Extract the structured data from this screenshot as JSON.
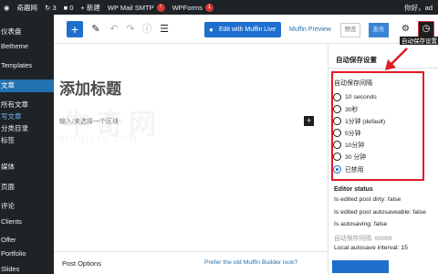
{
  "adminbar": {
    "site": "奇趣网",
    "updates_count": "3",
    "comments_count": "0",
    "new_label": "+ 新建",
    "wp_mail": "WP Mail SMTP",
    "wp_mail_badge": "!",
    "wpforms": "WPForms",
    "wpforms_badge": "1",
    "greeting": "你好，ad"
  },
  "sidebar": {
    "items": [
      {
        "label": "仪表盘"
      },
      {
        "label": "Betheme"
      },
      {
        "label": "Templates"
      },
      {
        "label": "文章"
      },
      {
        "label": "所有文章"
      },
      {
        "label": "写文章"
      },
      {
        "label": "分类目录"
      },
      {
        "label": "标签"
      },
      {
        "label": "媒体"
      },
      {
        "label": "页面"
      },
      {
        "label": "评论"
      },
      {
        "label": "Clients"
      },
      {
        "label": "Offer"
      },
      {
        "label": "Portfolio"
      },
      {
        "label": "Slides"
      }
    ]
  },
  "toolbar": {
    "edit_muffin": "Edit with Muffin Live",
    "muffin_preview": "Muffin Preview",
    "preview": "预览",
    "publish": "发布",
    "tooltip": "自动保存设置"
  },
  "content": {
    "title_placeholder": "添加标题",
    "block_placeholder": "输入/来选择一个区块",
    "watermark": "牛奇网",
    "watermark_url": "NIUQI360.COM",
    "post_options": "Post Options",
    "prefer_link": "Prefer the old Muffin Builder look?"
  },
  "panel": {
    "title": "自动保存设置",
    "group_label": "自动保存间隔",
    "options": [
      {
        "label": "10 seconds",
        "checked": false
      },
      {
        "label": "30秒",
        "checked": false
      },
      {
        "label": "1分钟 (default)",
        "checked": false
      },
      {
        "label": "5分钟",
        "checked": false
      },
      {
        "label": "10分钟",
        "checked": false
      },
      {
        "label": "30 分钟",
        "checked": false
      },
      {
        "label": "已禁用",
        "checked": true
      }
    ],
    "status_title": "Editor status",
    "status_lines": [
      "Is edited post dirty: false",
      "Is edited post autosaveable: false",
      "Is autosaving: false",
      "自动保存间隔: 99999",
      "Local autosave interval: 15"
    ]
  },
  "colors": {
    "admin_dark": "#1d2327",
    "accent_blue": "#1e6fce",
    "highlight_red": "#e21b24"
  }
}
